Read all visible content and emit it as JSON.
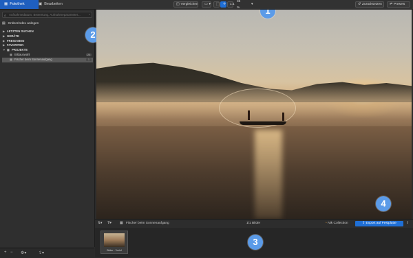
{
  "tabs": {
    "library": "Fotothek",
    "edit": "Bearbeiten"
  },
  "toolbar": {
    "compare": "Vergleichen",
    "zoom": "35 %",
    "reset": "Zurücksetzen",
    "presets": "Presets"
  },
  "sidebar": {
    "search_placeholder": "Aufnahmedatum, Bewertung, Aufnahmeparameter...",
    "folder_index": "Ordnerindex anlegen",
    "nodes": [
      {
        "label": "LETZTEN SUCHEN"
      },
      {
        "label": "GERÄTE"
      },
      {
        "label": "FREIGABEN"
      },
      {
        "label": "FAVORITEN"
      },
      {
        "label": "PROJEKTE"
      }
    ],
    "projects": [
      {
        "label": "Bildauswahl",
        "count": "20"
      },
      {
        "label": "Fischer beim Sonnenaufgang",
        "count": "1"
      }
    ]
  },
  "badges": {
    "b1": "1",
    "b2": "2",
    "b3": "3",
    "b4": "4"
  },
  "filmbar": {
    "album": "Fischer beim Sonnenaufgang",
    "count": "1/1 Bilder",
    "nik": "Nik Collection",
    "export": "Export auf Festplatte"
  },
  "thumbnail": {
    "label": "Bildar - Vorlef"
  }
}
